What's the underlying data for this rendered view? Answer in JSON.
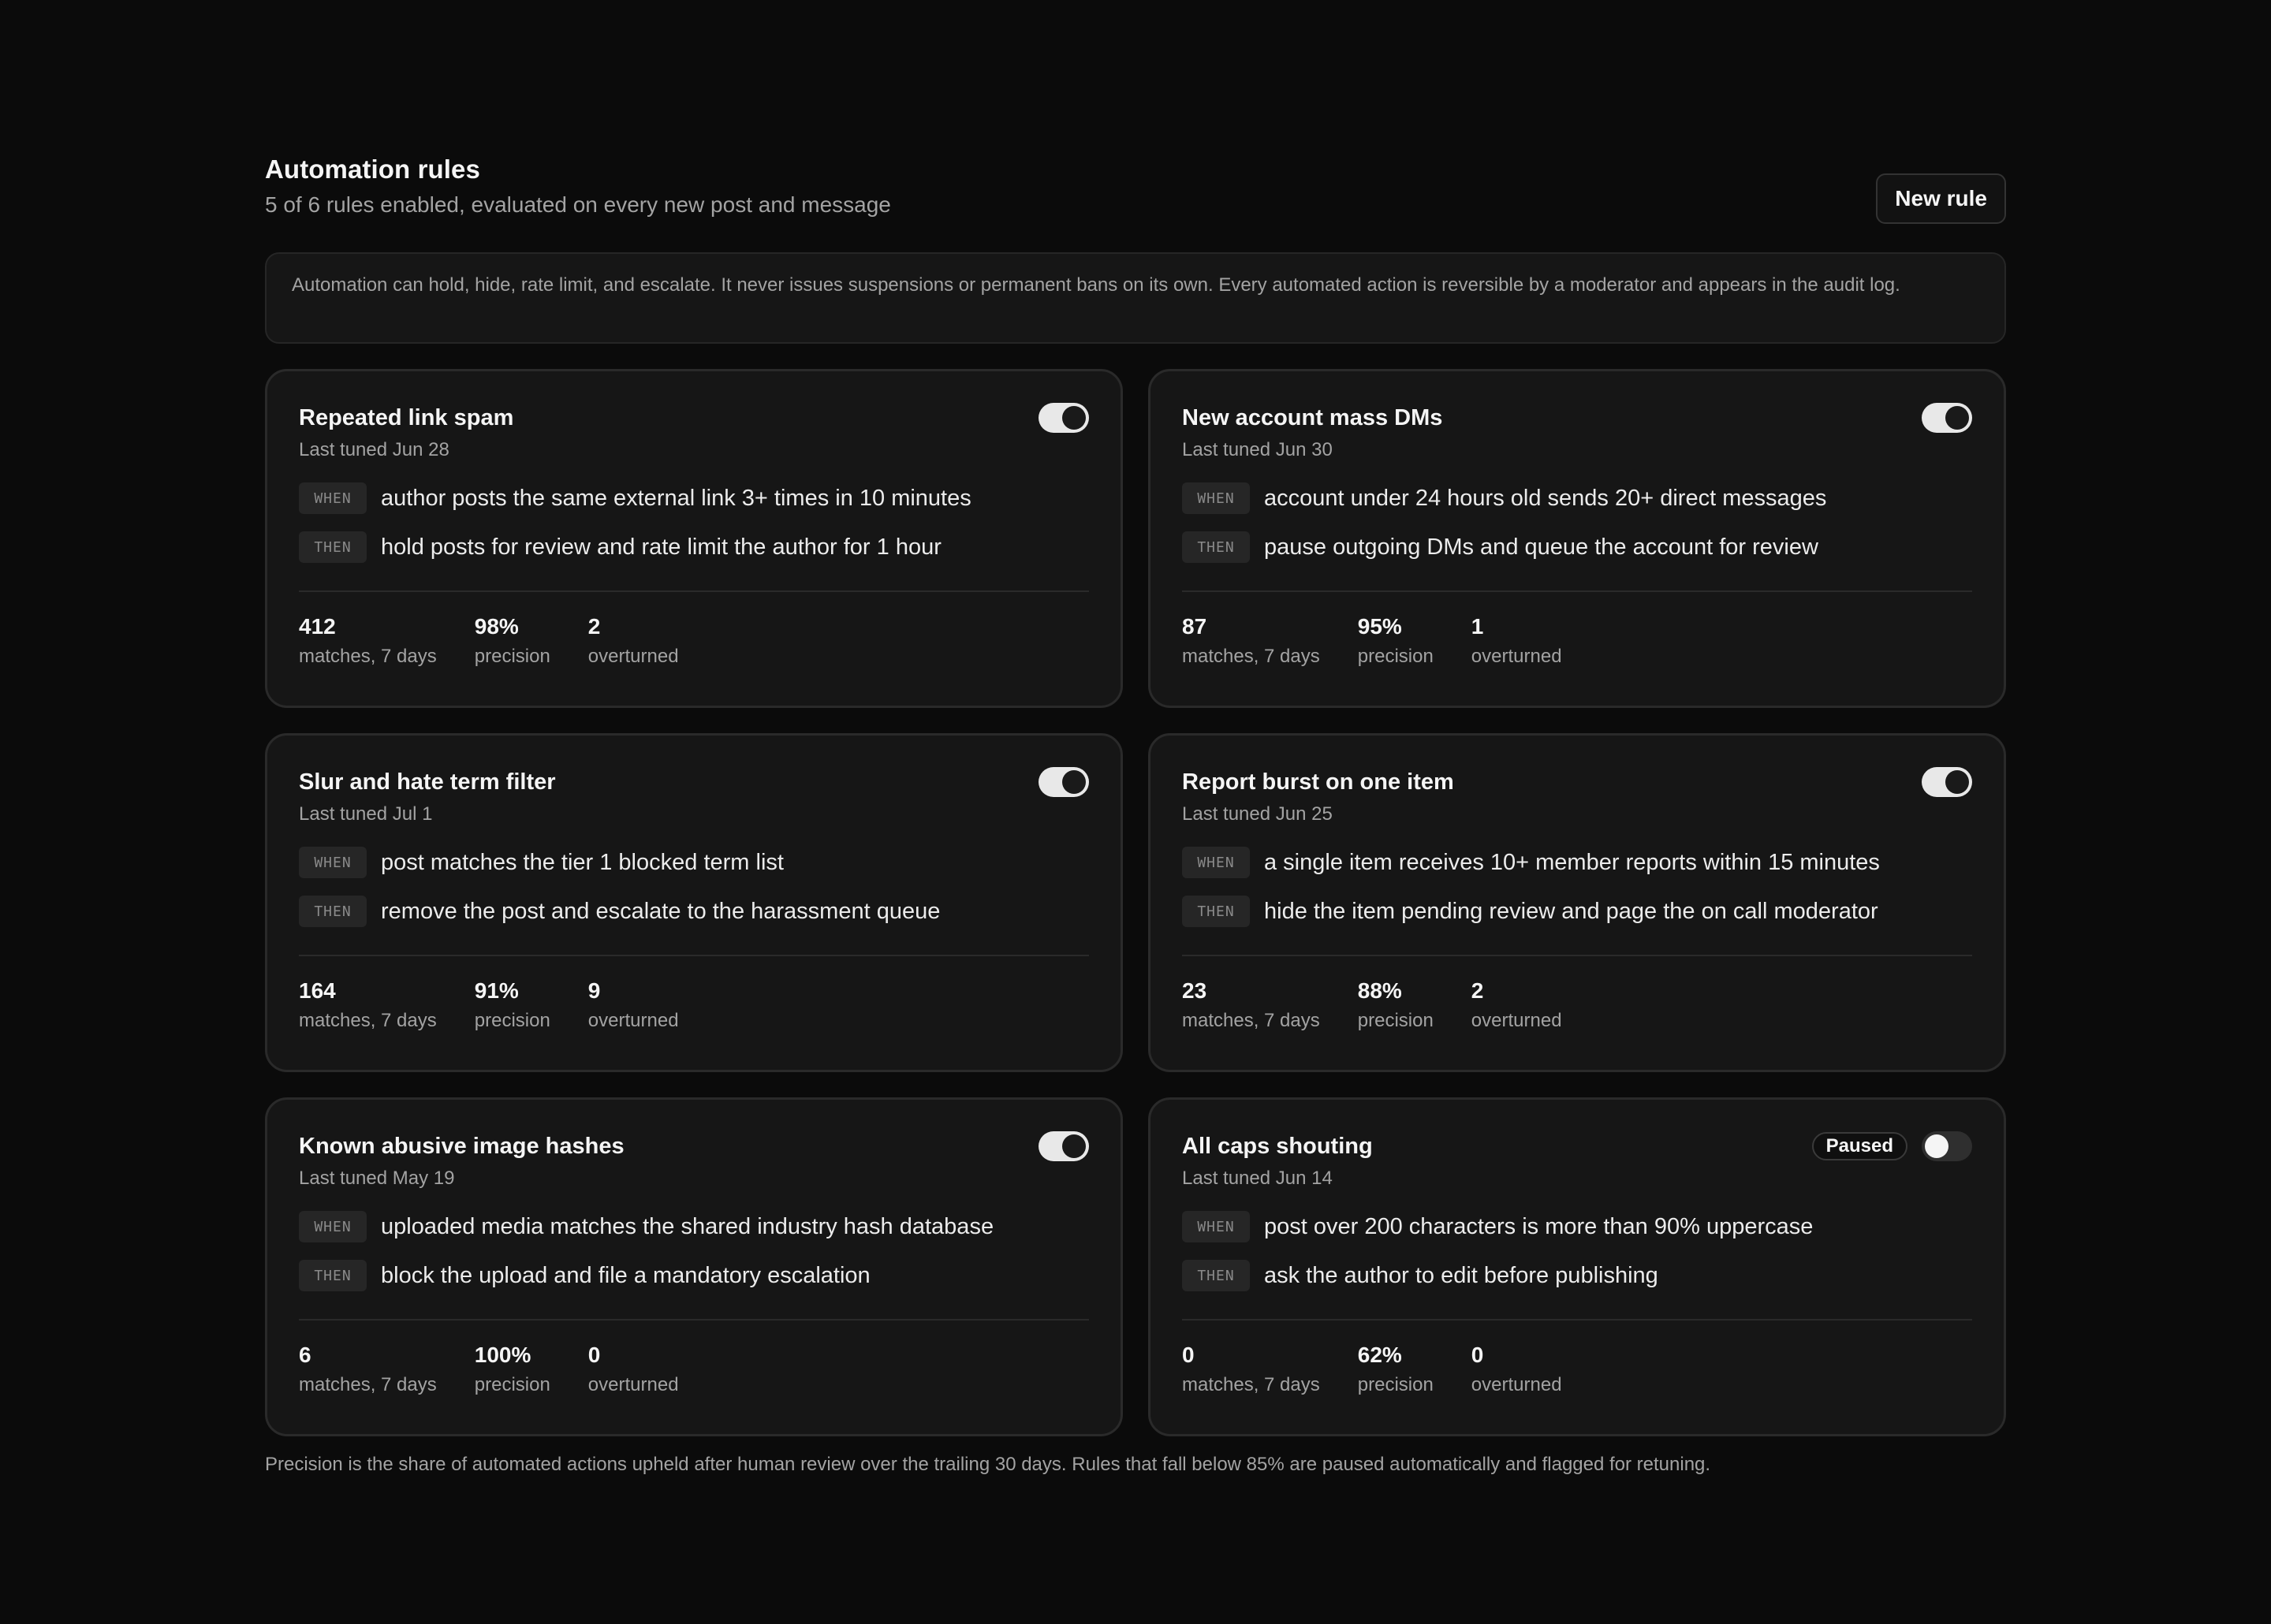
{
  "header": {
    "title": "Automation rules",
    "subtitle": "5 of 6 rules enabled, evaluated on every new post and message",
    "new_rule_label": "New rule"
  },
  "notice": "Automation can hold, hide, rate limit, and escalate. It never issues suspensions or permanent bans on its own. Every automated action is reversible by a moderator and appears in the audit log.",
  "labels": {
    "when": "WHEN",
    "then": "THEN",
    "matches": "matches, 7 days",
    "precision": "precision",
    "overturned": "overturned"
  },
  "rules": [
    {
      "name": "Repeated link spam",
      "tuned": "Last tuned Jun 28",
      "enabled": true,
      "when": "author posts the same external link 3+ times in 10 minutes",
      "then": "hold posts for review and rate limit the author for 1 hour",
      "matches": "412",
      "precision": "98%",
      "overturned": "2"
    },
    {
      "name": "New account mass DMs",
      "tuned": "Last tuned Jun 30",
      "enabled": true,
      "when": "account under 24 hours old sends 20+ direct messages",
      "then": "pause outgoing DMs and queue the account for review",
      "matches": "87",
      "precision": "95%",
      "overturned": "1"
    },
    {
      "name": "Slur and hate term filter",
      "tuned": "Last tuned Jul 1",
      "enabled": true,
      "when": "post matches the tier 1 blocked term list",
      "then": "remove the post and escalate to the harassment queue",
      "matches": "164",
      "precision": "91%",
      "overturned": "9"
    },
    {
      "name": "Report burst on one item",
      "tuned": "Last tuned Jun 25",
      "enabled": true,
      "when": "a single item receives 10+ member reports within 15 minutes",
      "then": "hide the item pending review and page the on call moderator",
      "matches": "23",
      "precision": "88%",
      "overturned": "2"
    },
    {
      "name": "Known abusive image hashes",
      "tuned": "Last tuned May 19",
      "enabled": true,
      "when": "uploaded media matches the shared industry hash database",
      "then": "block the upload and file a mandatory escalation",
      "matches": "6",
      "precision": "100%",
      "overturned": "0"
    },
    {
      "name": "All caps shouting",
      "tuned": "Last tuned Jun 14",
      "enabled": false,
      "status_badge": "Paused",
      "when": "post over 200 characters is more than 90% uppercase",
      "then": "ask the author to edit before publishing",
      "matches": "0",
      "precision": "62%",
      "overturned": "0"
    }
  ],
  "footnote": "Precision is the share of automated actions upheld after human review over the trailing 30 days. Rules that fall below 85% are paused automatically and flagged for retuning."
}
